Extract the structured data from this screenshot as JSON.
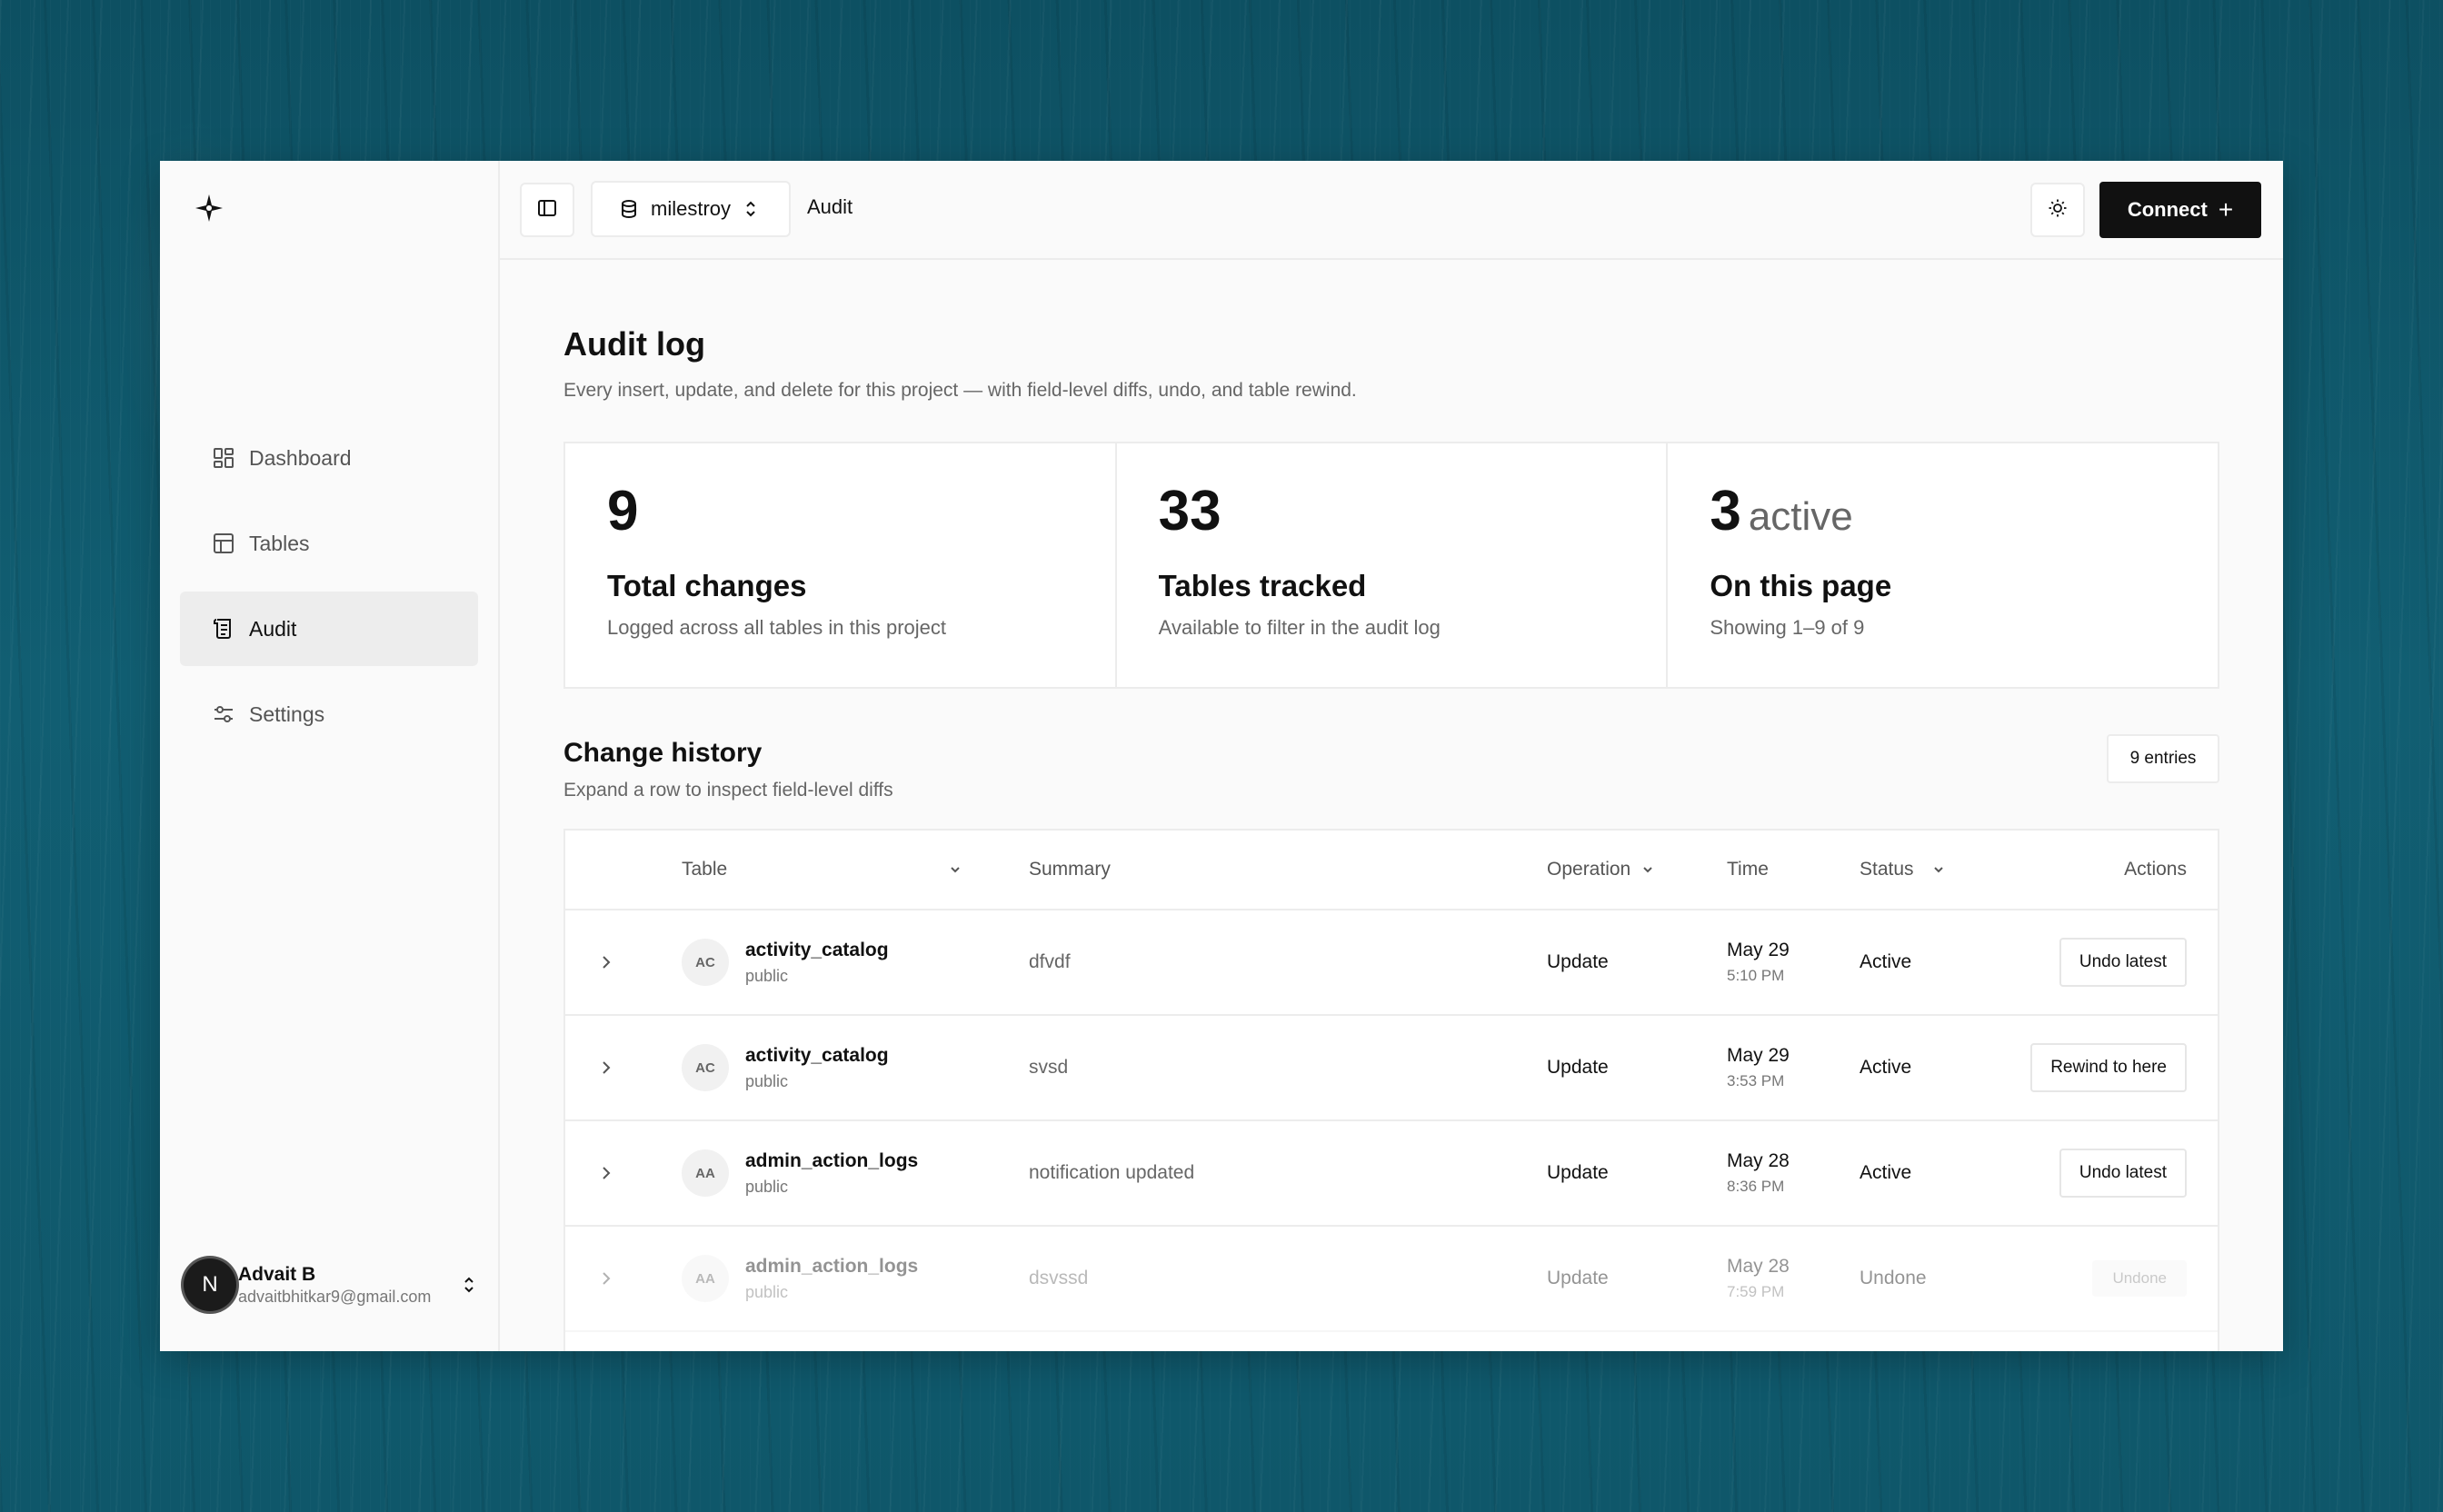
{
  "app": {
    "brand_color": "#111111",
    "background_color": "#0f576a"
  },
  "sidebar": {
    "items": [
      {
        "label": "Dashboard",
        "icon": "dashboard-icon",
        "active": false
      },
      {
        "label": "Tables",
        "icon": "table-icon",
        "active": false
      },
      {
        "label": "Audit",
        "icon": "audit-icon",
        "active": true
      },
      {
        "label": "Settings",
        "icon": "sliders-icon",
        "active": false
      }
    ],
    "user": {
      "initial": "N",
      "name": "Advait B",
      "email": "advaitbhitkar9@gmail.com"
    }
  },
  "topbar": {
    "project": "milestroy",
    "breadcrumb": "Audit",
    "connect_label": "Connect"
  },
  "page": {
    "title": "Audit log",
    "subtitle": "Every insert, update, and delete for this project — with field-level diffs, undo, and table rewind."
  },
  "stats": [
    {
      "value": "9",
      "suffix": "",
      "title": "Total changes",
      "desc": "Logged across all tables in this project"
    },
    {
      "value": "33",
      "suffix": "",
      "title": "Tables tracked",
      "desc": "Available to filter in the audit log"
    },
    {
      "value": "3",
      "suffix": "active",
      "title": "On this page",
      "desc": "Showing 1–9 of 9"
    }
  ],
  "history": {
    "title": "Change history",
    "subtitle": "Expand a row to inspect field-level diffs",
    "entries_label": "9 entries",
    "columns": {
      "table": "Table",
      "summary": "Summary",
      "operation": "Operation",
      "time": "Time",
      "status": "Status",
      "actions": "Actions"
    },
    "rows": [
      {
        "initials": "AC",
        "table": "activity_catalog",
        "schema": "public",
        "summary": "dfvdf",
        "operation": "Update",
        "date": "May 29",
        "time": "5:10 PM",
        "status": "Active",
        "action": "Undo latest"
      },
      {
        "initials": "AC",
        "table": "activity_catalog",
        "schema": "public",
        "summary": "svsd",
        "operation": "Update",
        "date": "May 29",
        "time": "3:53 PM",
        "status": "Active",
        "action": "Rewind to here"
      },
      {
        "initials": "AA",
        "table": "admin_action_logs",
        "schema": "public",
        "summary": "notification updated",
        "operation": "Update",
        "date": "May 28",
        "time": "8:36 PM",
        "status": "Active",
        "action": "Undo latest"
      },
      {
        "initials": "AA",
        "table": "admin_action_logs",
        "schema": "public",
        "summary": "dsvssd",
        "operation": "Update",
        "date": "May 28",
        "time": "7:59 PM",
        "status": "Undone",
        "action": "Undone"
      }
    ]
  }
}
